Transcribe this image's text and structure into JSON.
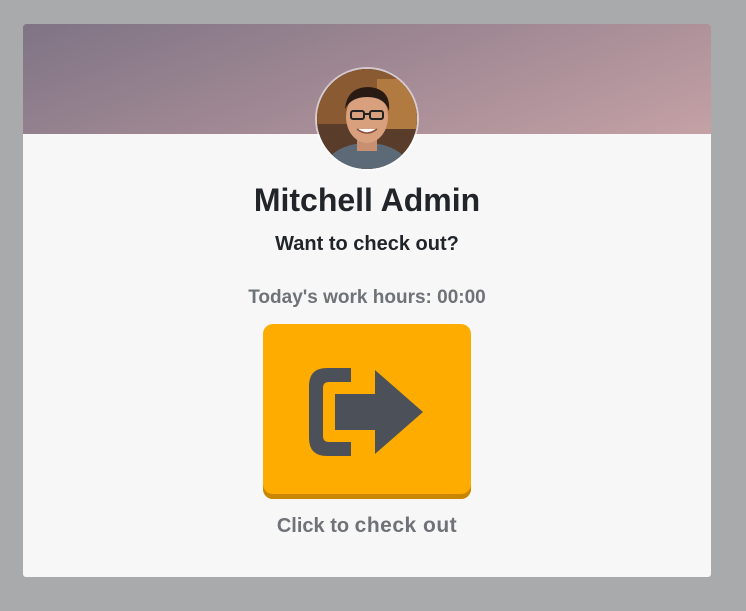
{
  "employee": {
    "name": "Mitchell Admin"
  },
  "prompt": {
    "question": "Want to check out?"
  },
  "work_hours": {
    "label": "Today's work hours: 00:00"
  },
  "action": {
    "icon": "sign-out-icon",
    "hint_prefix": "Click to",
    "hint_action": "check out",
    "button_color": "#ffac00",
    "icon_color": "#4c5159"
  },
  "colors": {
    "page_background": "#a9aaab",
    "card_background": "#f7f7f7"
  }
}
